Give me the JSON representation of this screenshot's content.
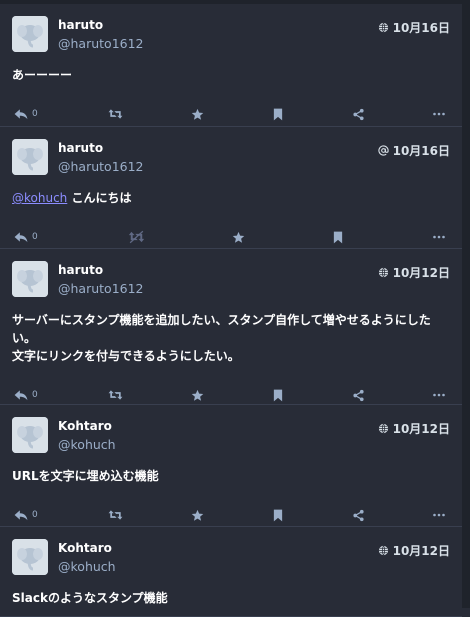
{
  "posts": [
    {
      "display_name": "haruto",
      "handle": "@haruto1612",
      "visibility_icon": "globe-icon",
      "time": "10月16日",
      "content": [
        {
          "text": "あーーーー"
        }
      ],
      "reply_count": "0",
      "actions": [
        "reply-icon",
        "boost-icon",
        "star-icon",
        "bookmark-icon",
        "share-icon",
        "more-icon"
      ]
    },
    {
      "display_name": "haruto",
      "handle": "@haruto1612",
      "visibility_icon": "at-icon",
      "time": "10月16日",
      "content": [
        {
          "mention": "@kohuch",
          "text": " こんにちは"
        }
      ],
      "reply_count": "0",
      "actions": [
        "reply-icon",
        "boost-disabled-icon",
        "star-icon",
        "bookmark-icon",
        "more-icon"
      ]
    },
    {
      "display_name": "haruto",
      "handle": "@haruto1612",
      "visibility_icon": "globe-icon",
      "time": "10月12日",
      "content": [
        {
          "text": "サーバーにスタンプ機能を追加したい、スタンプ自作して増やせるようにした"
        },
        {
          "text": "い。"
        },
        {
          "text": "文字にリンクを付与できるようにしたい。"
        }
      ],
      "reply_count": "0",
      "actions": [
        "reply-icon",
        "boost-icon",
        "star-icon",
        "bookmark-icon",
        "share-icon",
        "more-icon"
      ]
    },
    {
      "display_name": "Kohtaro",
      "handle": "@kohuch",
      "visibility_icon": "globe-icon",
      "time": "10月12日",
      "content": [
        {
          "text": "URLを文字に埋め込む機能"
        }
      ],
      "reply_count": "0",
      "actions": [
        "reply-icon",
        "boost-icon",
        "star-icon",
        "bookmark-icon",
        "share-icon",
        "more-icon"
      ]
    },
    {
      "display_name": "Kohtaro",
      "handle": "@kohuch",
      "visibility_icon": "globe-icon",
      "time": "10月12日",
      "content": [
        {
          "text": "Slackのようなスタンプ機能"
        }
      ],
      "reply_count": "",
      "actions": []
    }
  ]
}
